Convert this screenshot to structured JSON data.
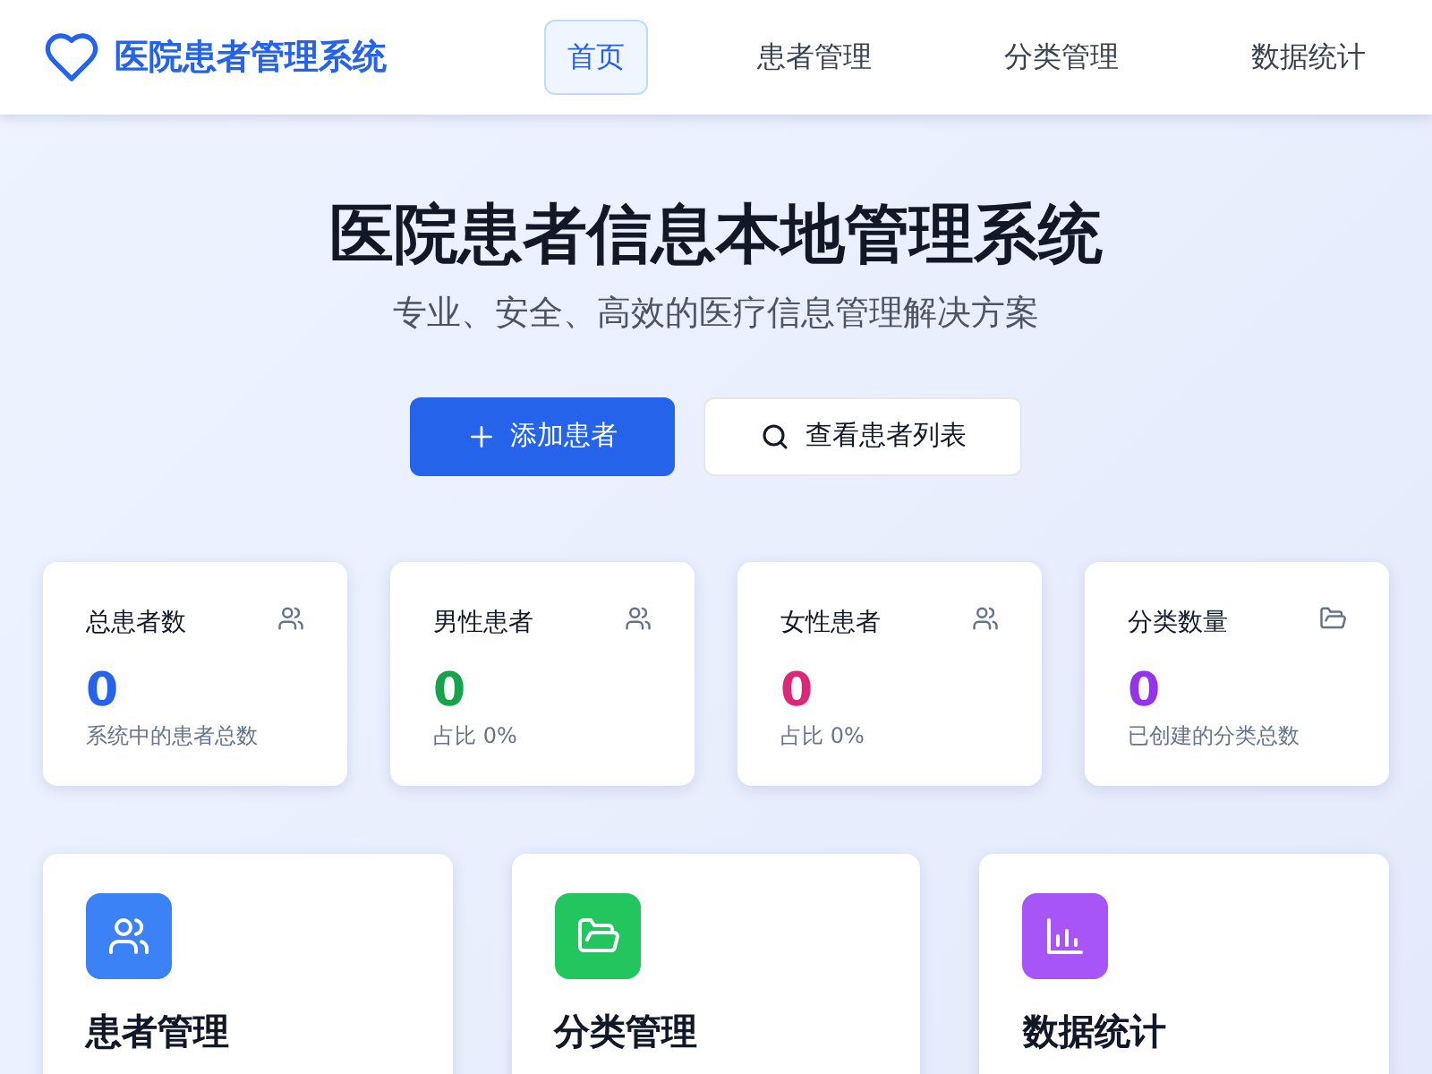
{
  "brand": {
    "title": "医院患者管理系统"
  },
  "nav": [
    {
      "label": "首页",
      "selected": true
    },
    {
      "label": "患者管理",
      "selected": false
    },
    {
      "label": "分类管理",
      "selected": false
    },
    {
      "label": "数据统计",
      "selected": false
    }
  ],
  "hero": {
    "title": "医院患者信息本地管理系统",
    "subtitle": "专业、安全、高效的医疗信息管理解决方案",
    "buttons": [
      {
        "label": "添加患者",
        "kind": "primary"
      },
      {
        "label": "查看患者列表",
        "kind": "secondary"
      }
    ]
  },
  "stats": [
    {
      "label": "总患者数",
      "kind": "users",
      "value": "0",
      "note": "系统中的患者总数",
      "color": "#2563eb"
    },
    {
      "label": "男性患者",
      "kind": "users",
      "value": "0",
      "note": "占比 0%",
      "color": "#16a34a"
    },
    {
      "label": "女性患者",
      "kind": "users",
      "value": "0",
      "note": "占比 0%",
      "color": "#db2777"
    },
    {
      "label": "分类数量",
      "kind": "folder",
      "value": "0",
      "note": "已创建的分类总数",
      "color": "#9333ea"
    }
  ],
  "features": [
    {
      "title": "患者管理",
      "kind": "users",
      "color": "#3b82f6"
    },
    {
      "title": "分类管理",
      "kind": "folder",
      "color": "#22c55e"
    },
    {
      "title": "数据统计",
      "kind": "chart",
      "color": "#a855f7"
    }
  ]
}
